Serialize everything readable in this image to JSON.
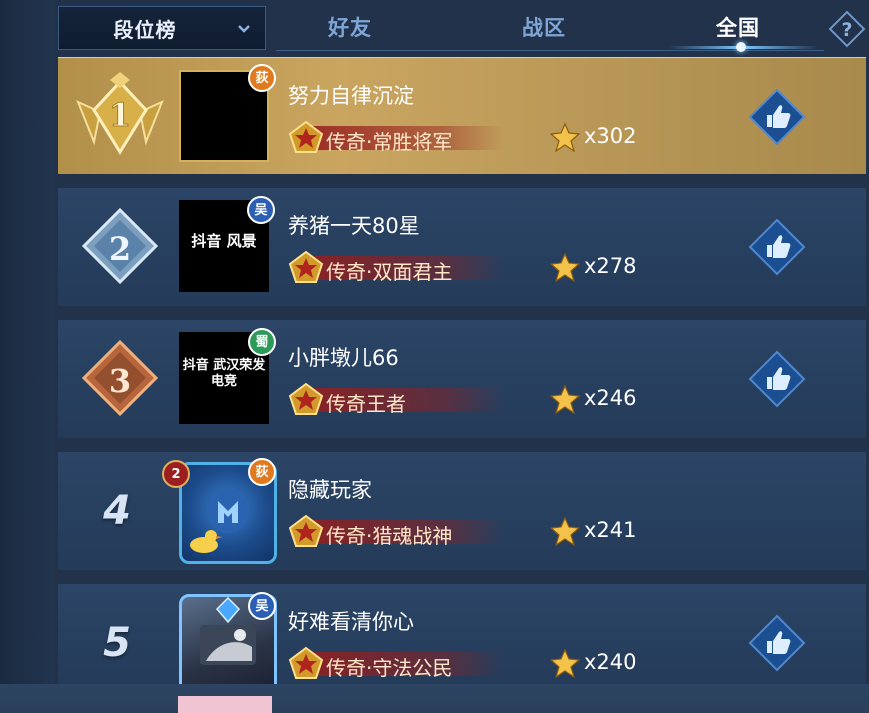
{
  "header": {
    "dropdown_label": "段位榜",
    "tabs": [
      {
        "label": "好友",
        "active": false
      },
      {
        "label": "战区",
        "active": false
      },
      {
        "label": "全国",
        "active": true
      }
    ],
    "help_icon": "question-diamond-icon"
  },
  "colors": {
    "gold_row": "#c9a560",
    "row_bg": "#2c4566",
    "rank_plate": "#961e1e",
    "tab_inactive": "#7fa6d6",
    "like_button": "#1c4f92"
  },
  "players": [
    {
      "rank": "1",
      "name": "努力自律沉淀",
      "rank_title": "传奇·常胜将军",
      "stars": "x302",
      "server_badge": "荻",
      "badge_color": "#e07a1e",
      "avatar_caption": ""
    },
    {
      "rank": "2",
      "name": "养猪一天80星",
      "rank_title": "传奇·双面君主",
      "stars": "x278",
      "server_badge": "吴",
      "badge_color": "#2b5fb5",
      "avatar_caption": "抖音 风景"
    },
    {
      "rank": "3",
      "name": "小胖墩儿66",
      "rank_title": "传奇王者",
      "stars": "x246",
      "server_badge": "蜀",
      "badge_color": "#2e9a5a",
      "avatar_caption": "抖音 武汉荣发电竞"
    },
    {
      "rank": "4",
      "name": "隐藏玩家",
      "rank_title": "传奇·猎魂战神",
      "stars": "x241",
      "server_badge": "荻",
      "badge_color": "#e07a1e",
      "avatar_level": "2"
    },
    {
      "rank": "5",
      "name": "好难看清你心",
      "rank_title": "传奇·守法公民",
      "stars": "x240",
      "server_badge": "吴",
      "badge_color": "#2b5fb5"
    }
  ]
}
